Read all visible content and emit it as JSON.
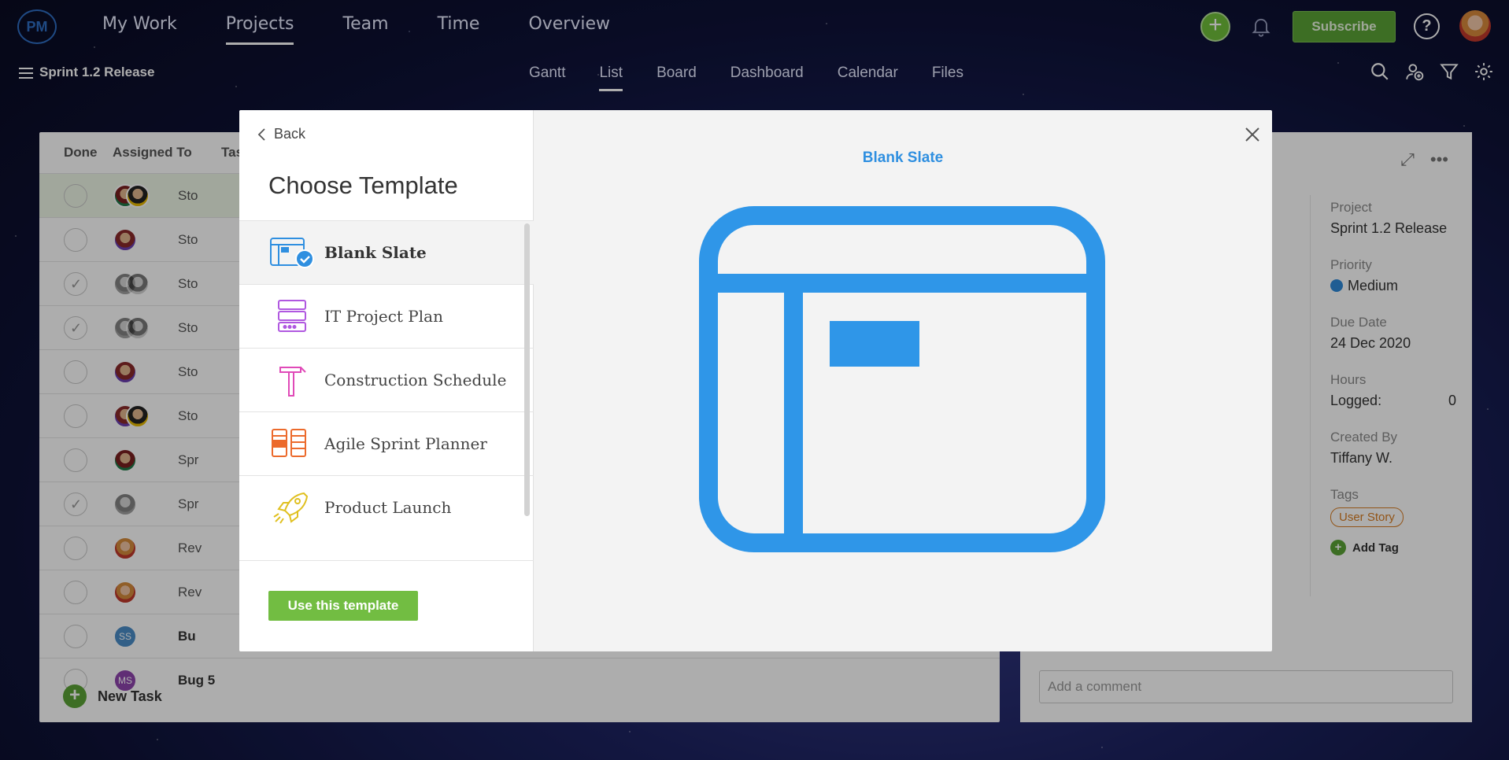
{
  "topnav": {
    "logo": "PM",
    "items": [
      {
        "label": "My Work",
        "active": false
      },
      {
        "label": "Projects",
        "active": true
      },
      {
        "label": "Team",
        "active": false
      },
      {
        "label": "Time",
        "active": false
      },
      {
        "label": "Overview",
        "active": false
      }
    ],
    "subscribe_label": "Subscribe",
    "help_label": "?"
  },
  "subbar": {
    "project_name": "Sprint 1.2 Release",
    "views": [
      {
        "label": "Gantt",
        "active": false
      },
      {
        "label": "List",
        "active": true
      },
      {
        "label": "Board",
        "active": false
      },
      {
        "label": "Dashboard",
        "active": false
      },
      {
        "label": "Calendar",
        "active": false
      },
      {
        "label": "Files",
        "active": false
      }
    ]
  },
  "list": {
    "columns": {
      "done": "Done",
      "assigned": "Assigned To",
      "task": "Tas"
    },
    "rows": [
      {
        "text": "Sto"
      },
      {
        "text": "Sto"
      },
      {
        "text": "Sto"
      },
      {
        "text": "Sto"
      },
      {
        "text": "Sto"
      },
      {
        "text": "Sto"
      },
      {
        "text": "Spr"
      },
      {
        "text": "Spr"
      },
      {
        "text": "Rev"
      },
      {
        "text": "Rev"
      },
      {
        "text": "Bu",
        "avatar": "SS"
      },
      {
        "text": "Bug 5",
        "avatar": "MS"
      }
    ],
    "new_task_label": "New Task"
  },
  "detail": {
    "project_label": "Project",
    "project_value": "Sprint 1.2 Release",
    "priority_label": "Priority",
    "priority_value": "Medium",
    "due_label": "Due Date",
    "due_value": "24 Dec 2020",
    "hours_label": "Hours",
    "logged_label": "Logged:",
    "logged_value": "0",
    "created_label": "Created By",
    "created_value": "Tiffany W.",
    "tags_label": "Tags",
    "tag": "User Story",
    "add_tag_label": "Add Tag",
    "comment_placeholder": "Add a comment"
  },
  "modal": {
    "back_label": "Back",
    "title": "Choose Template",
    "templates": [
      {
        "label": "Blank Slate",
        "icon": "blank-slate-icon",
        "active": true
      },
      {
        "label": "IT Project Plan",
        "icon": "it-project-icon",
        "active": false
      },
      {
        "label": "Construction Schedule",
        "icon": "hammer-icon",
        "active": false
      },
      {
        "label": "Agile Sprint Planner",
        "icon": "agile-board-icon",
        "active": false
      },
      {
        "label": "Product Launch",
        "icon": "rocket-icon",
        "active": false
      }
    ],
    "use_button_label": "Use this template",
    "preview_title": "Blank Slate"
  },
  "colors": {
    "accent_blue": "#2f8fe0",
    "green": "#72bd42",
    "tag_orange": "#d77d22"
  }
}
